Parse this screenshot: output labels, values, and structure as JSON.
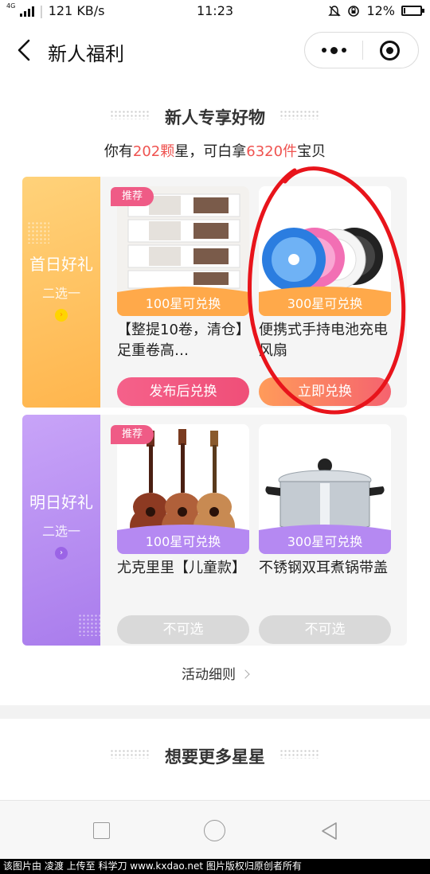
{
  "status_bar": {
    "network": "4G",
    "speed": "121 KB/s",
    "time": "11:23",
    "battery": "12%",
    "battery_level": 0.12
  },
  "nav": {
    "title": "新人福利"
  },
  "section1": {
    "title": "新人专享好物",
    "subtitle": {
      "prefix": "你有",
      "stars": "202颗",
      "middle": "星，可白拿",
      "items": "6320件",
      "suffix": "宝贝"
    }
  },
  "rows": [
    {
      "label": "首日好礼",
      "sublabel": "二选一",
      "products": [
        {
          "tag": "推荐",
          "price": "100星可兑换",
          "name": "【整提10卷，清仓】足重卷高…",
          "button": "发布后兑换"
        },
        {
          "price": "300星可兑换",
          "name": "便携式手持电池充电风扇",
          "button": "立即兑换"
        }
      ]
    },
    {
      "label": "明日好礼",
      "sublabel": "二选一",
      "products": [
        {
          "tag": "推荐",
          "price": "100星可兑换",
          "name": "尤克里里【儿童款】",
          "button": "不可选"
        },
        {
          "price": "300星可兑换",
          "name": "不锈钢双耳煮锅带盖",
          "button": "不可选"
        }
      ]
    }
  ],
  "rules_link": "活动细则",
  "section2": {
    "title": "想要更多星星"
  },
  "watermark": "该图片由 凌渡 上传至 科学刀 www.kxdao.net 图片版权归原创者所有",
  "colors": {
    "accent_red": "#ef5350",
    "orange": "#ffa23a",
    "pink": "#f0507a",
    "purple": "#b38af0"
  }
}
